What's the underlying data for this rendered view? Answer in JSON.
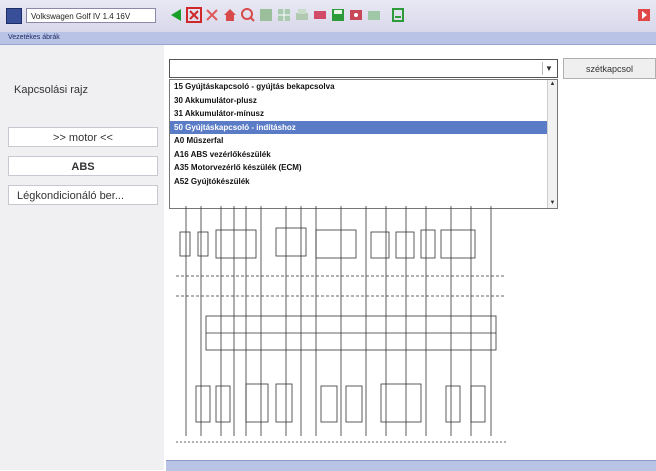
{
  "window": {
    "title": "Volkswagen Golf IV 1.4 16V",
    "subtitle": "Vezetékes ábrák"
  },
  "sidebar": {
    "diagram_label": "Kapcsolási rajz",
    "buttons": [
      {
        "label": ">> motor <<"
      },
      {
        "label": "ABS"
      },
      {
        "label": "Légkondicionáló ber..."
      }
    ]
  },
  "action_button": {
    "label": "szétkapcsol"
  },
  "dropdown": {
    "selected": "",
    "options": [
      "15 Gyújtáskapcsoló - gyújtás bekapcsolva",
      "30 Akkumulátor-plusz",
      "31 Akkumulátor-mínusz",
      "50 Gyújtáskapcsoló - indításhoz",
      "A0 Műszerfal",
      "A16 ABS vezérlőkészülék",
      "A35 Motorvezérlő készülék (ECM)",
      "A52 Gyújtókészülék"
    ],
    "highlighted_index": 3
  },
  "colors": {
    "accent": "#5a7bc6",
    "toolbar_bg": "#dedeee",
    "strip": "#b9c3e6"
  },
  "toolbar_icons": [
    "logo-icon",
    "back-arrow-icon",
    "wiring-icon",
    "tools-icon",
    "home-icon",
    "search-icon",
    "zoom-icon",
    "grid-icon",
    "print-icon",
    "save-icon",
    "connector-icon",
    "settings-icon",
    "export-icon",
    "close-icon"
  ]
}
